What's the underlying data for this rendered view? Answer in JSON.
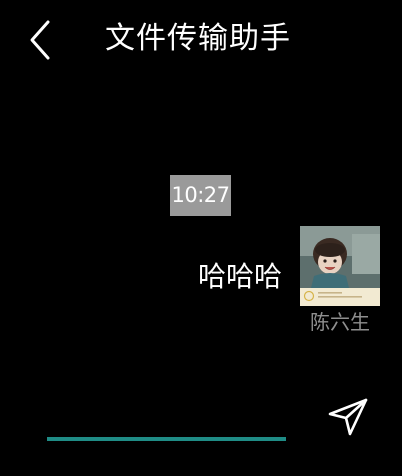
{
  "header": {
    "title": "文件传输助手",
    "back_icon": "back-chevron-icon"
  },
  "chat": {
    "timestamp": "10:27",
    "messages": [
      {
        "text": "哈哈哈",
        "sender": "陈六生",
        "avatar": "avatar-photo"
      }
    ]
  },
  "composer": {
    "send_icon": "send-icon"
  },
  "colors": {
    "background": "#000000",
    "accent_line": "#1f8c86",
    "timestamp_bg": "#9a9a9a",
    "sender_name": "#8f8f8f",
    "text": "#ffffff"
  }
}
